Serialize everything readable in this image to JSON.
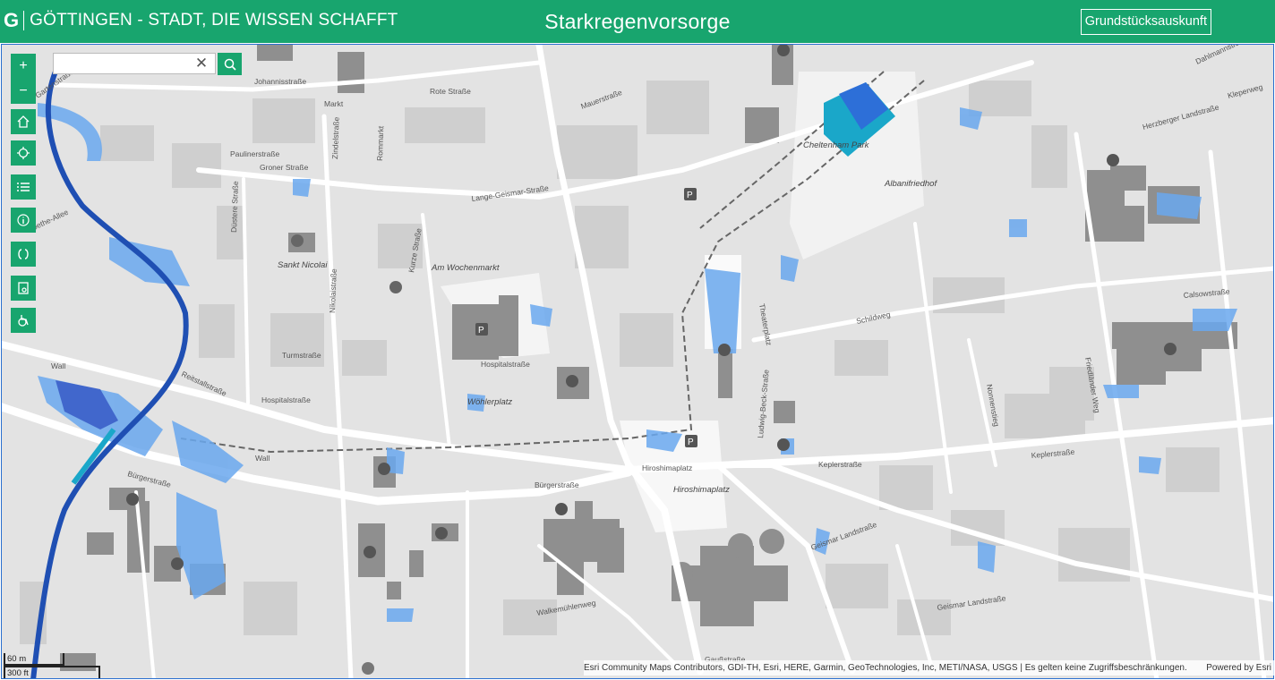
{
  "header": {
    "logo_mark": "G",
    "logo_text": "GÖTTINGEN - STADT, DIE WISSEN SCHAFFT",
    "title": "Starkregenvorsorge",
    "parcel_button": "Grundstücksauskunft"
  },
  "colors": {
    "brand_green": "#18a56e",
    "water_light": "#6aa8ee",
    "water_dark": "#1f4fb3",
    "building": "#8f8f8f"
  },
  "search": {
    "value": "",
    "placeholder": ""
  },
  "controls": [
    {
      "name": "zoom-in",
      "icon": "plus-icon"
    },
    {
      "name": "zoom-out",
      "icon": "minus-icon"
    },
    {
      "name": "home",
      "icon": "home-icon"
    },
    {
      "name": "locate",
      "icon": "locate-icon"
    },
    {
      "name": "layer-list",
      "icon": "list-icon"
    },
    {
      "name": "info",
      "icon": "info-icon"
    },
    {
      "name": "swipe",
      "icon": "swipe-icon"
    },
    {
      "name": "print",
      "icon": "print-icon"
    },
    {
      "name": "accessibility",
      "icon": "wheelchair-icon"
    }
  ],
  "map_labels": {
    "roter_strasse": "Rote Straße",
    "johannisstrasse": "Johannisstraße",
    "markt": "Markt",
    "paulinerstrasse": "Paulinerstraße",
    "zindelstrasse": "Zindelstraße",
    "rommarkt": "Rommarkt",
    "groner_strasse": "Groner Straße",
    "lange_geismar": "Lange-Geismar-Straße",
    "mauerstrasse": "Mauerstraße",
    "cheltenham_park": "Cheltenham Park",
    "albanifriedhof": "Albanifriedhof",
    "sankt_nicolai": "Sankt Nicolai",
    "am_wochenmarkt": "Am Wochenmarkt",
    "hospitalstrasse": "Hospitalstraße",
    "turmstrasse": "Turmstraße",
    "woehlerplatz": "Wöhlerplatz",
    "buergerstrasse": "Bürgerstraße",
    "wall": "Wall",
    "hiroshimaplatz": "Hiroshimaplatz",
    "keplerstrasse": "Keplerstraße",
    "schildweg": "Schildweg",
    "geismar_landstrasse": "Geismar Landstraße",
    "gausstrasse": "Gaußstraße",
    "walkemuehlenweg": "Walkemühlenweg",
    "herzberger": "Herzberger Landstraße",
    "dahlmannstrasse": "Dahlmannstraße",
    "calsowstrasse": "Calsowstraße",
    "kleperweg": "Kleperweg",
    "gartenstrasse": "Gartenstraße",
    "reitstallstrasse": "Reitstallstraße",
    "goethe": "Goethe-Allee",
    "friedlaender": "Friedländer Weg",
    "nonnenstieg": "Nonnenstieg",
    "duestere": "Düstere Straße",
    "kurze_strasse": "Kurze Straße",
    "nikolaistrasse": "Nikolaistraße",
    "theaterplatz": "Theaterplatz",
    "ludwig_beck": "Ludwig-Beck-Straße"
  },
  "attribution": {
    "text": "Esri Community Maps Contributors, GDI-TH, Esri, HERE, Garmin, GeoTechnologies, Inc, METI/NASA, USGS | Es gelten keine Zugriffsbeschränkungen.",
    "powered": "Powered by Esri"
  },
  "scale": {
    "metric": "60 m",
    "imperial": "300 ft"
  }
}
